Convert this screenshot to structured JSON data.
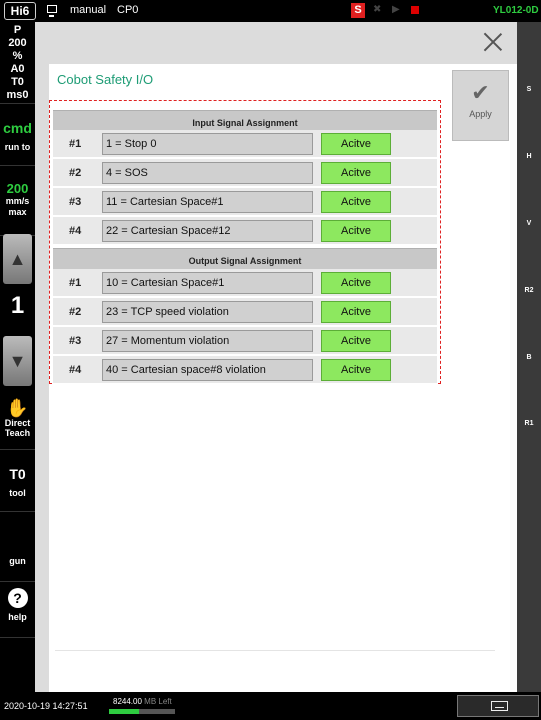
{
  "topbar": {
    "logo": "Hi6",
    "mode": "manual",
    "program": "CP0",
    "s_badge": "S",
    "robot_id": "YL012-0D"
  },
  "leftbar": {
    "status_lines": [
      "P",
      "200",
      "%",
      "A0",
      "T0",
      "ms0"
    ],
    "cmd_label": "cmd",
    "run_to_label": "run to",
    "speed_value": "200",
    "speed_unit_1": "mm/s",
    "speed_unit_2": "max",
    "step_number": "1",
    "direct_teach_1": "Direct",
    "direct_teach_2": "Teach",
    "tool_value": "T0",
    "tool_label": "tool",
    "gun_label": "gun",
    "help_icon_text": "?",
    "help_label": "help"
  },
  "rightbar": {
    "labels": [
      "S",
      "H",
      "V",
      "R2",
      "B",
      "R1"
    ]
  },
  "dialog": {
    "title": "Cobot Safety I/O",
    "apply_label": "Apply",
    "input_section_title": "Input Signal Assignment",
    "output_section_title": "Output Signal Assignment",
    "input_rows": [
      {
        "num": "#1",
        "value": "1 = Stop 0",
        "status": "Acitve"
      },
      {
        "num": "#2",
        "value": "4 = SOS",
        "status": "Acitve"
      },
      {
        "num": "#3",
        "value": "11 = Cartesian Space#1",
        "status": "Acitve"
      },
      {
        "num": "#4",
        "value": "22 = Cartesian Space#12",
        "status": "Acitve"
      }
    ],
    "output_rows": [
      {
        "num": "#1",
        "value": "10 = Cartesian Space#1",
        "status": "Acitve"
      },
      {
        "num": "#2",
        "value": "23 = TCP speed violation",
        "status": "Acitve"
      },
      {
        "num": "#3",
        "value": "27 = Momentum violation",
        "status": "Acitve"
      },
      {
        "num": "#4",
        "value": "40 = Cartesian space#8 violation",
        "status": "Acitve"
      }
    ]
  },
  "bottombar": {
    "datetime": "2020-10-19 14:27:51",
    "memory_value": "8244.00",
    "memory_label": "MB Left",
    "memory_fraction": 0.45
  },
  "colors": {
    "accent_green": "#1e9c75",
    "active_green": "#8de85f",
    "status_green": "#2ecc40",
    "highlight_red": "#e02020"
  }
}
